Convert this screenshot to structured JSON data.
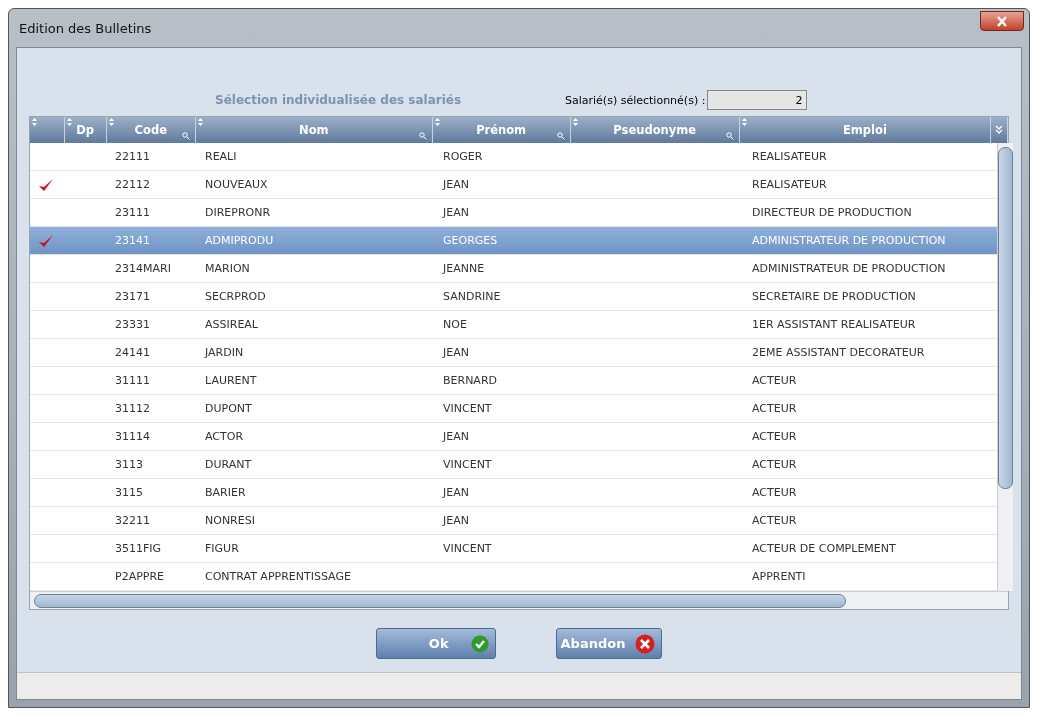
{
  "window": {
    "title": "Edition des Bulletins"
  },
  "subtitle": "Sélection individualisée des salariés",
  "selected_count": {
    "label": "Salarié(s) sélectionné(s) :",
    "value": "2"
  },
  "table": {
    "columns": [
      "Dp",
      "Code",
      "Nom",
      "Prénom",
      "Pseudonyme",
      "Emploi"
    ],
    "rows": [
      {
        "checked": false,
        "selected": false,
        "code": "22111",
        "nom": "REALI",
        "prenom": "ROGER",
        "emploi": "REALISATEUR"
      },
      {
        "checked": true,
        "selected": false,
        "code": "22112",
        "nom": "NOUVEAUX",
        "prenom": "JEAN",
        "emploi": "REALISATEUR"
      },
      {
        "checked": false,
        "selected": false,
        "code": "23111",
        "nom": "DIREPRONR",
        "prenom": "JEAN",
        "emploi": "DIRECTEUR DE PRODUCTION"
      },
      {
        "checked": true,
        "selected": true,
        "code": "23141",
        "nom": "ADMIPRODU",
        "prenom": "GEORGES",
        "emploi": "ADMINISTRATEUR DE PRODUCTION"
      },
      {
        "checked": false,
        "selected": false,
        "code": "2314MARI",
        "nom": "MARION",
        "prenom": "JEANNE",
        "emploi": "ADMINISTRATEUR DE PRODUCTION"
      },
      {
        "checked": false,
        "selected": false,
        "code": "23171",
        "nom": "SECRPROD",
        "prenom": "SANDRINE",
        "emploi": "SECRETAIRE DE PRODUCTION"
      },
      {
        "checked": false,
        "selected": false,
        "code": "23331",
        "nom": "ASSIREAL",
        "prenom": "NOE",
        "emploi": "1ER ASSISTANT REALISATEUR"
      },
      {
        "checked": false,
        "selected": false,
        "code": "24141",
        "nom": "JARDIN",
        "prenom": "JEAN",
        "emploi": "2EME ASSISTANT DECORATEUR"
      },
      {
        "checked": false,
        "selected": false,
        "code": "31111",
        "nom": "LAURENT",
        "prenom": "BERNARD",
        "emploi": "ACTEUR"
      },
      {
        "checked": false,
        "selected": false,
        "code": "31112",
        "nom": "DUPONT",
        "prenom": "VINCENT",
        "emploi": "ACTEUR"
      },
      {
        "checked": false,
        "selected": false,
        "code": "31114",
        "nom": "ACTOR",
        "prenom": "JEAN",
        "emploi": "ACTEUR"
      },
      {
        "checked": false,
        "selected": false,
        "code": "3113",
        "nom": "DURANT",
        "prenom": "VINCENT",
        "emploi": "ACTEUR"
      },
      {
        "checked": false,
        "selected": false,
        "code": "3115",
        "nom": "BARIER",
        "prenom": "JEAN",
        "emploi": "ACTEUR"
      },
      {
        "checked": false,
        "selected": false,
        "code": "32211",
        "nom": "NONRESI",
        "prenom": "JEAN",
        "emploi": "ACTEUR"
      },
      {
        "checked": false,
        "selected": false,
        "code": "3511FIG",
        "nom": "FIGUR",
        "prenom": "VINCENT",
        "emploi": "ACTEUR DE COMPLEMENT"
      },
      {
        "checked": false,
        "selected": false,
        "code": "P2APPRE",
        "nom": "CONTRAT APPRENTISSAGE",
        "prenom": "",
        "emploi": "APPRENTI"
      }
    ]
  },
  "buttons": [
    {
      "label": "Ok",
      "kind": "ok"
    },
    {
      "label": "Abandon",
      "kind": "cancel"
    }
  ]
}
